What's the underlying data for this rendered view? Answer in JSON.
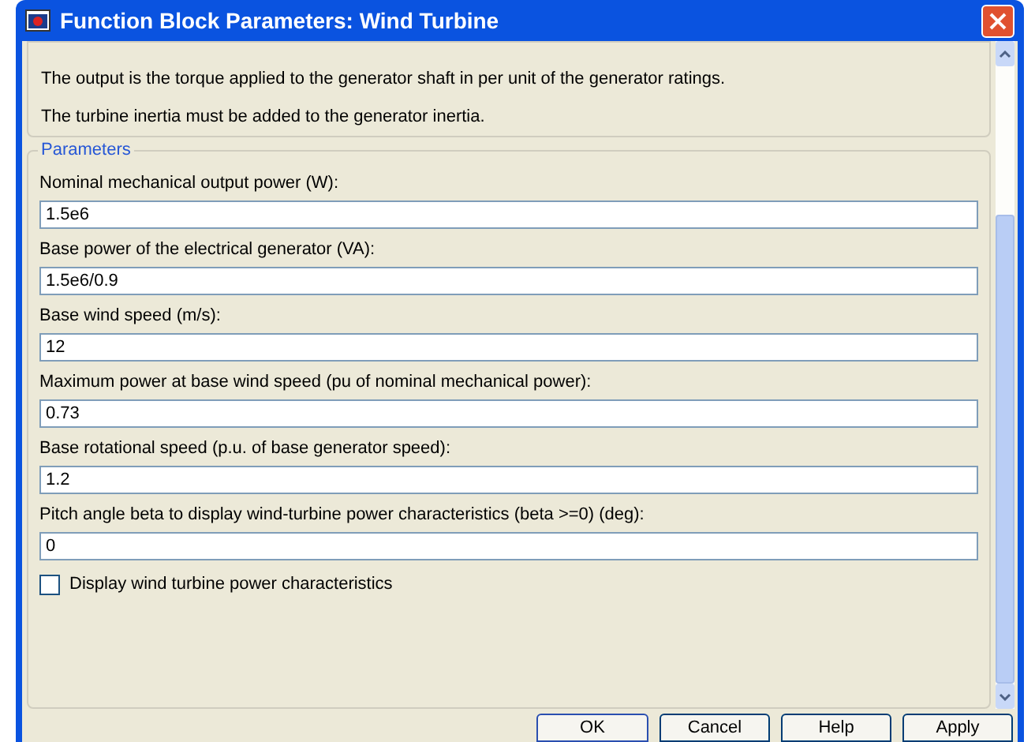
{
  "window": {
    "title": "Function Block Parameters: Wind Turbine"
  },
  "description": [
    "The output is the torque applied to the generator shaft in per unit of the generator ratings.",
    "The turbine inertia must be added to the generator inertia."
  ],
  "parameters": {
    "title": "Parameters",
    "fields": [
      {
        "label": "Nominal mechanical output power (W):",
        "value": "1.5e6"
      },
      {
        "label": "Base power of the electrical generator (VA):",
        "value": "1.5e6/0.9"
      },
      {
        "label": "Base wind speed (m/s):",
        "value": "12"
      },
      {
        "label": "Maximum power at base wind speed (pu of nominal mechanical power):",
        "value": "0.73"
      },
      {
        "label": "Base rotational speed (p.u. of base generator speed):",
        "value": "1.2"
      },
      {
        "label": "Pitch angle beta to display wind-turbine power characteristics (beta >=0)  (deg):",
        "value": "0"
      }
    ],
    "checkbox": {
      "label": "Display wind turbine power characteristics",
      "checked": false
    }
  },
  "buttons": [
    "OK",
    "Cancel",
    "Help",
    "Apply"
  ]
}
